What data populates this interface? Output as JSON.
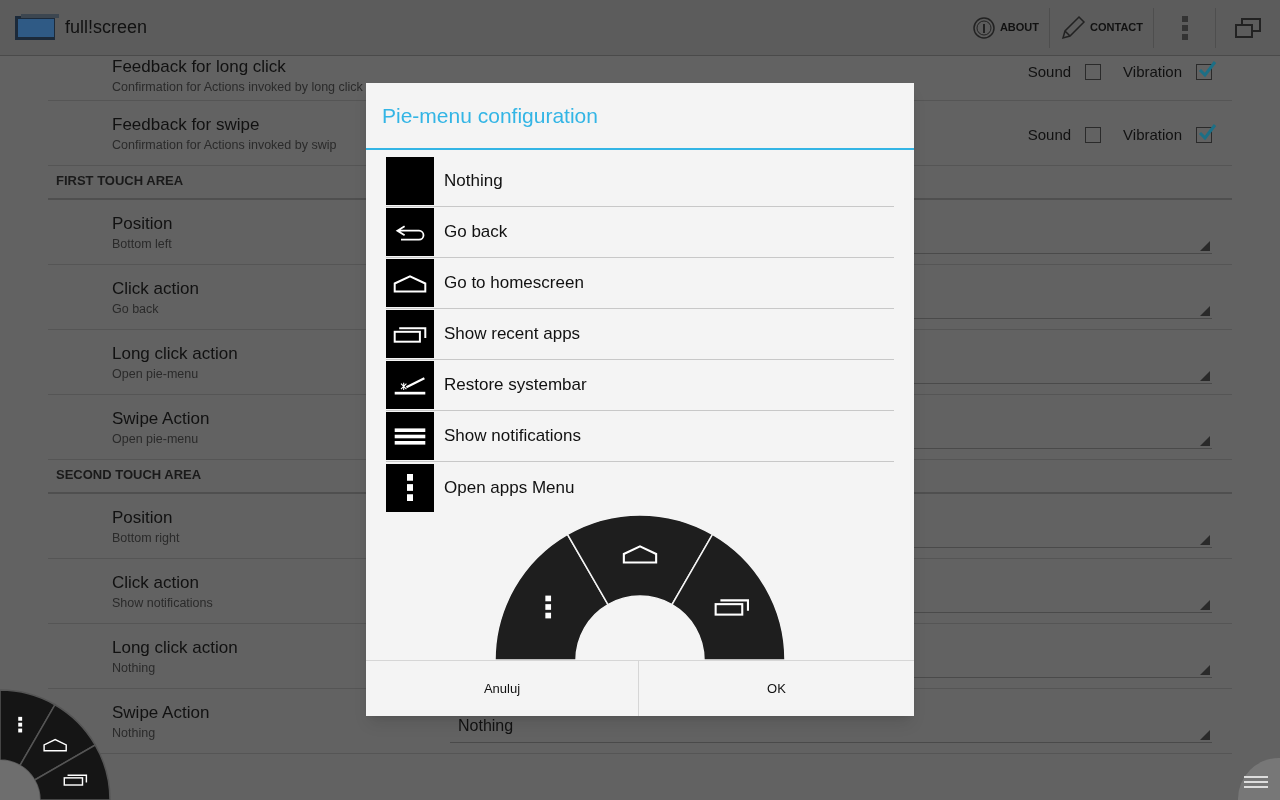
{
  "app_bar": {
    "title": "full!screen",
    "actions": [
      {
        "label": "ABOUT",
        "kind": "info"
      },
      {
        "label": "CONTACT",
        "kind": "pencil"
      }
    ]
  },
  "settings": [
    {
      "kind": "checkboxes",
      "title": "Feedback for long click",
      "subtitle": "Confirmation for Actions invoked by long click",
      "checks": [
        {
          "label": "Sound",
          "checked": false
        },
        {
          "label": "Vibration",
          "checked": true
        }
      ]
    },
    {
      "kind": "checkboxes",
      "title": "Feedback for swipe",
      "subtitle": "Confirmation for Actions invoked by swip",
      "checks": [
        {
          "label": "Sound",
          "checked": false
        },
        {
          "label": "Vibration",
          "checked": true
        }
      ]
    },
    {
      "kind": "header",
      "title": "FIRST TOUCH AREA"
    },
    {
      "kind": "dropdown",
      "title": "Position",
      "subtitle": "Bottom left"
    },
    {
      "kind": "dropdown",
      "title": "Click action",
      "subtitle": "Go back"
    },
    {
      "kind": "dropdown",
      "title": "Long click action",
      "subtitle": "Open pie-menu"
    },
    {
      "kind": "dropdown",
      "title": "Swipe Action",
      "subtitle": "Open pie-menu"
    },
    {
      "kind": "header",
      "title": "SECOND TOUCH AREA"
    },
    {
      "kind": "dropdown",
      "title": "Position",
      "subtitle": "Bottom right"
    },
    {
      "kind": "dropdown",
      "title": "Click action",
      "subtitle": "Show notifications"
    },
    {
      "kind": "dropdown",
      "title": "Long click action",
      "subtitle": "Nothing"
    },
    {
      "kind": "dropdown",
      "title": "Swipe Action",
      "subtitle": "Nothing",
      "value": "Nothing"
    }
  ],
  "dialog": {
    "title": "Pie-menu configuration",
    "options": [
      {
        "label": "Nothing",
        "kind": "none"
      },
      {
        "label": "Go back",
        "kind": "back"
      },
      {
        "label": "Go to homescreen",
        "kind": "home"
      },
      {
        "label": "Show recent apps",
        "kind": "recent"
      },
      {
        "label": "Restore systembar",
        "kind": "systembar"
      },
      {
        "label": "Show notifications",
        "kind": "notifications"
      },
      {
        "label": "Open apps Menu",
        "kind": "menu"
      }
    ],
    "pie_segments": [
      {
        "kind": "menu"
      },
      {
        "kind": "home"
      },
      {
        "kind": "recent"
      }
    ],
    "buttons": [
      "Anuluj",
      "OK"
    ]
  },
  "floating_pie": {
    "segments": [
      {
        "kind": "menu"
      },
      {
        "kind": "home"
      },
      {
        "kind": "recent"
      }
    ]
  }
}
